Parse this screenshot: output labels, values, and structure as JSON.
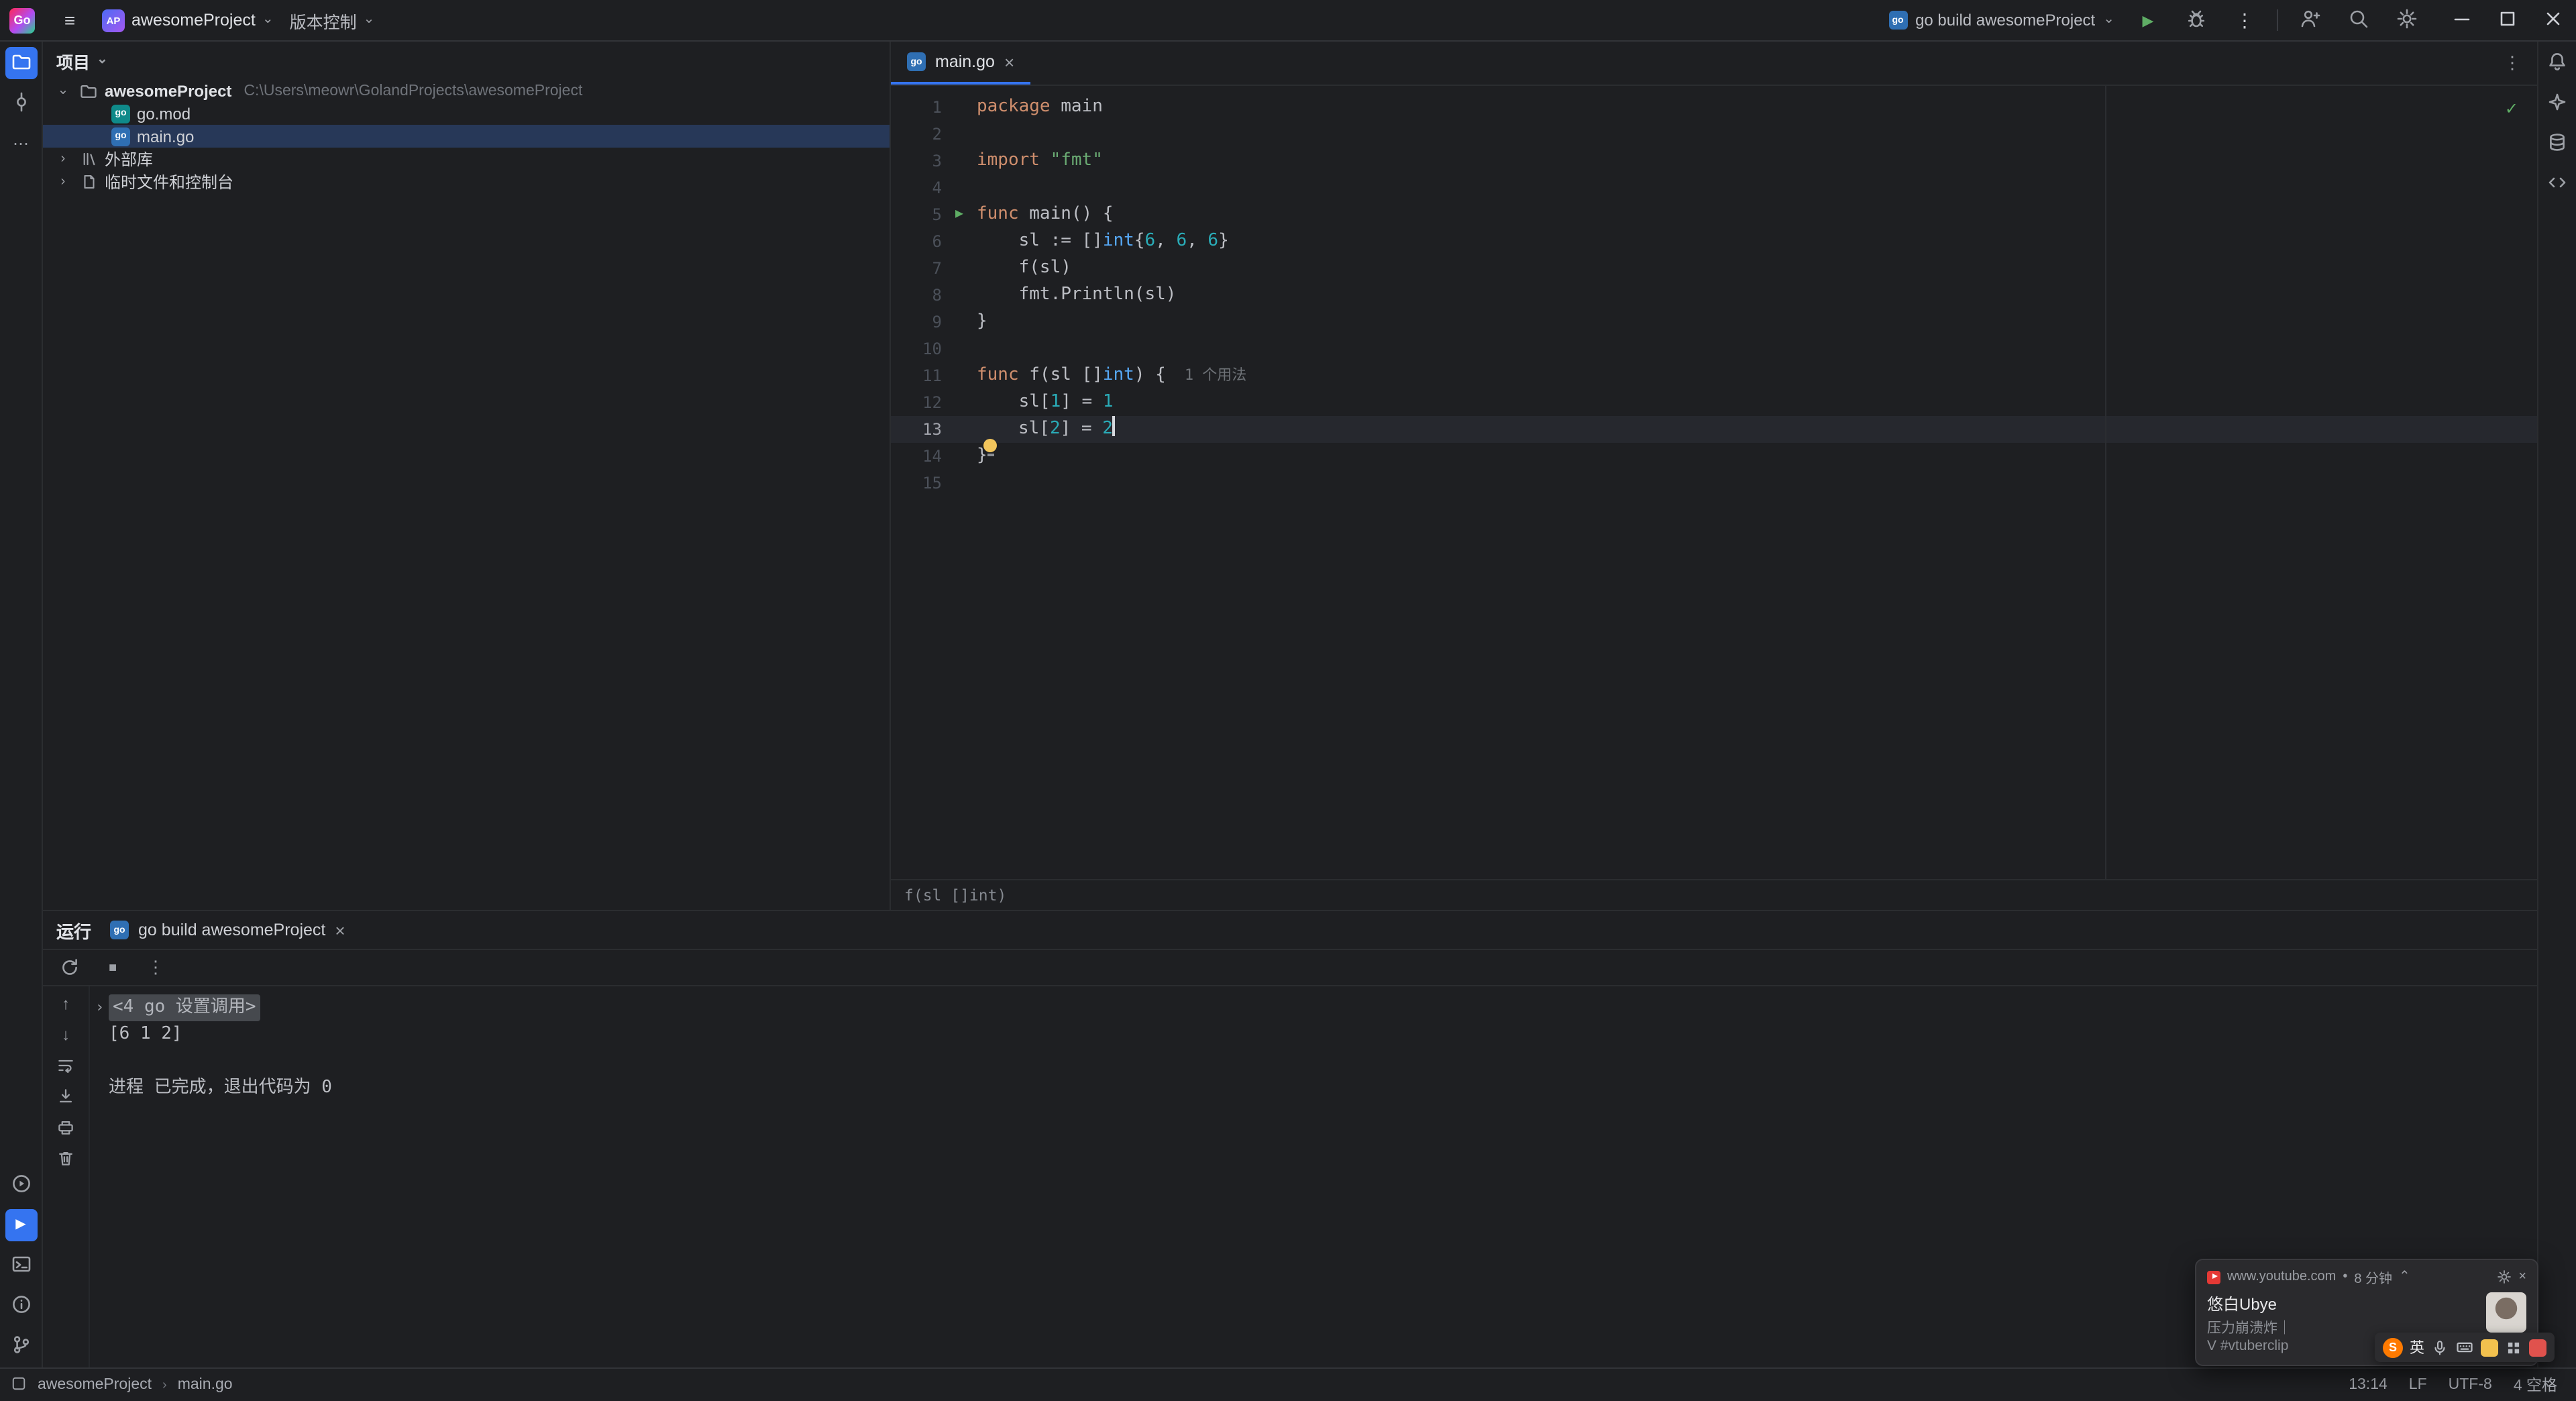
{
  "colors": {
    "accent": "#3574f0",
    "run_green": "#5fad65",
    "keyword": "#cf8e6d",
    "string": "#6aab73",
    "number": "#2aacb8",
    "type": "#56a8f5"
  },
  "icons": {
    "hamburger": "≡",
    "chevron_down": "⌄",
    "chevron_right": "›",
    "chevron_up": "⌃",
    "kebab": "⋮",
    "ellipsis": "⋯",
    "play": "▶",
    "stop": "■",
    "check": "✓",
    "arrow_up": "↑",
    "arrow_down": "↓",
    "close": "×",
    "bullet": "•",
    "logo_letter": "Go",
    "go_chip": "go"
  },
  "titlebar": {
    "project_badge": "AP",
    "project_name": "awesomeProject",
    "vcs_label": "版本控制",
    "run_config_label": "go build awesomeProject"
  },
  "project_panel": {
    "title": "项目",
    "root_name": "awesomeProject",
    "root_path": "C:\\Users\\meowr\\GolandProjects\\awesomeProject",
    "items": [
      {
        "label": "go.mod",
        "icon": "go-mod-file-icon",
        "indent": 1,
        "selected": false,
        "chevron": false
      },
      {
        "label": "main.go",
        "icon": "go-file-icon",
        "indent": 1,
        "selected": true,
        "chevron": false
      },
      {
        "label": "外部库",
        "icon": "library-icon",
        "indent": 0,
        "selected": false,
        "chevron": true
      },
      {
        "label": "临时文件和控制台",
        "icon": "scratch-icon",
        "indent": 0,
        "selected": false,
        "chevron": true
      }
    ]
  },
  "editor": {
    "tab_label": "main.go",
    "breadcrumb": "f(sl []int)",
    "lines": [
      {
        "n": 1,
        "tokens": [
          [
            "package",
            "kw"
          ],
          [
            " main",
            ""
          ]
        ]
      },
      {
        "n": 2,
        "tokens": []
      },
      {
        "n": 3,
        "tokens": [
          [
            "import",
            "kw"
          ],
          [
            " ",
            ""
          ],
          [
            "\"fmt\"",
            "str"
          ]
        ]
      },
      {
        "n": 4,
        "tokens": []
      },
      {
        "n": 5,
        "icon": "run",
        "tokens": [
          [
            "func",
            "kw"
          ],
          [
            " main() {",
            ""
          ]
        ]
      },
      {
        "n": 6,
        "tokens": [
          [
            "    sl := []",
            ""
          ],
          [
            "int",
            "typ"
          ],
          [
            "{",
            ""
          ],
          [
            "6",
            "num"
          ],
          [
            ", ",
            ""
          ],
          [
            "6",
            "num"
          ],
          [
            ", ",
            ""
          ],
          [
            "6",
            "num"
          ],
          [
            "}",
            ""
          ]
        ]
      },
      {
        "n": 7,
        "tokens": [
          [
            "    f(sl)",
            ""
          ]
        ]
      },
      {
        "n": 8,
        "tokens": [
          [
            "    fmt.Println(sl)",
            ""
          ]
        ]
      },
      {
        "n": 9,
        "tokens": [
          [
            "}",
            ""
          ]
        ]
      },
      {
        "n": 10,
        "tokens": []
      },
      {
        "n": 11,
        "tokens": [
          [
            "func",
            "kw"
          ],
          [
            " f(sl []",
            ""
          ],
          [
            "int",
            "typ"
          ],
          [
            ") {",
            ""
          ]
        ],
        "inlay": "1 个用法"
      },
      {
        "n": 12,
        "tokens": [
          [
            "    sl[",
            ""
          ],
          [
            "1",
            "num"
          ],
          [
            "] = ",
            ""
          ],
          [
            "1",
            "num"
          ]
        ]
      },
      {
        "n": 13,
        "current": true,
        "bulb": true,
        "caret": true,
        "tokens": [
          [
            "sl[",
            ""
          ],
          [
            "2",
            "num"
          ],
          [
            "] = ",
            ""
          ],
          [
            "2",
            "num"
          ]
        ]
      },
      {
        "n": 14,
        "tokens": [
          [
            "}",
            ""
          ]
        ]
      },
      {
        "n": 15,
        "tokens": []
      }
    ]
  },
  "run_panel": {
    "title": "运行",
    "tab_label": "go build awesomeProject",
    "console": [
      {
        "type": "fold",
        "text": "<4 go 设置调用>"
      },
      {
        "type": "out",
        "text": "[6 1 2]"
      },
      {
        "type": "blank",
        "text": ""
      },
      {
        "type": "out",
        "text": "进程 已完成，退出代码为 0"
      }
    ]
  },
  "statusbar": {
    "project": "awesomeProject",
    "file": "main.go",
    "caret_position": "13:14",
    "line_ending": "LF",
    "encoding": "UTF-8",
    "indent": "4 空格"
  },
  "toast": {
    "source": "www.youtube.com",
    "sep": "•",
    "time": "8 分钟",
    "title": "悠白Ubye",
    "line1": "压力崩溃炸｜",
    "line2": "V #vtuberclip"
  },
  "ime": {
    "sogou": "S",
    "lang": "英"
  }
}
